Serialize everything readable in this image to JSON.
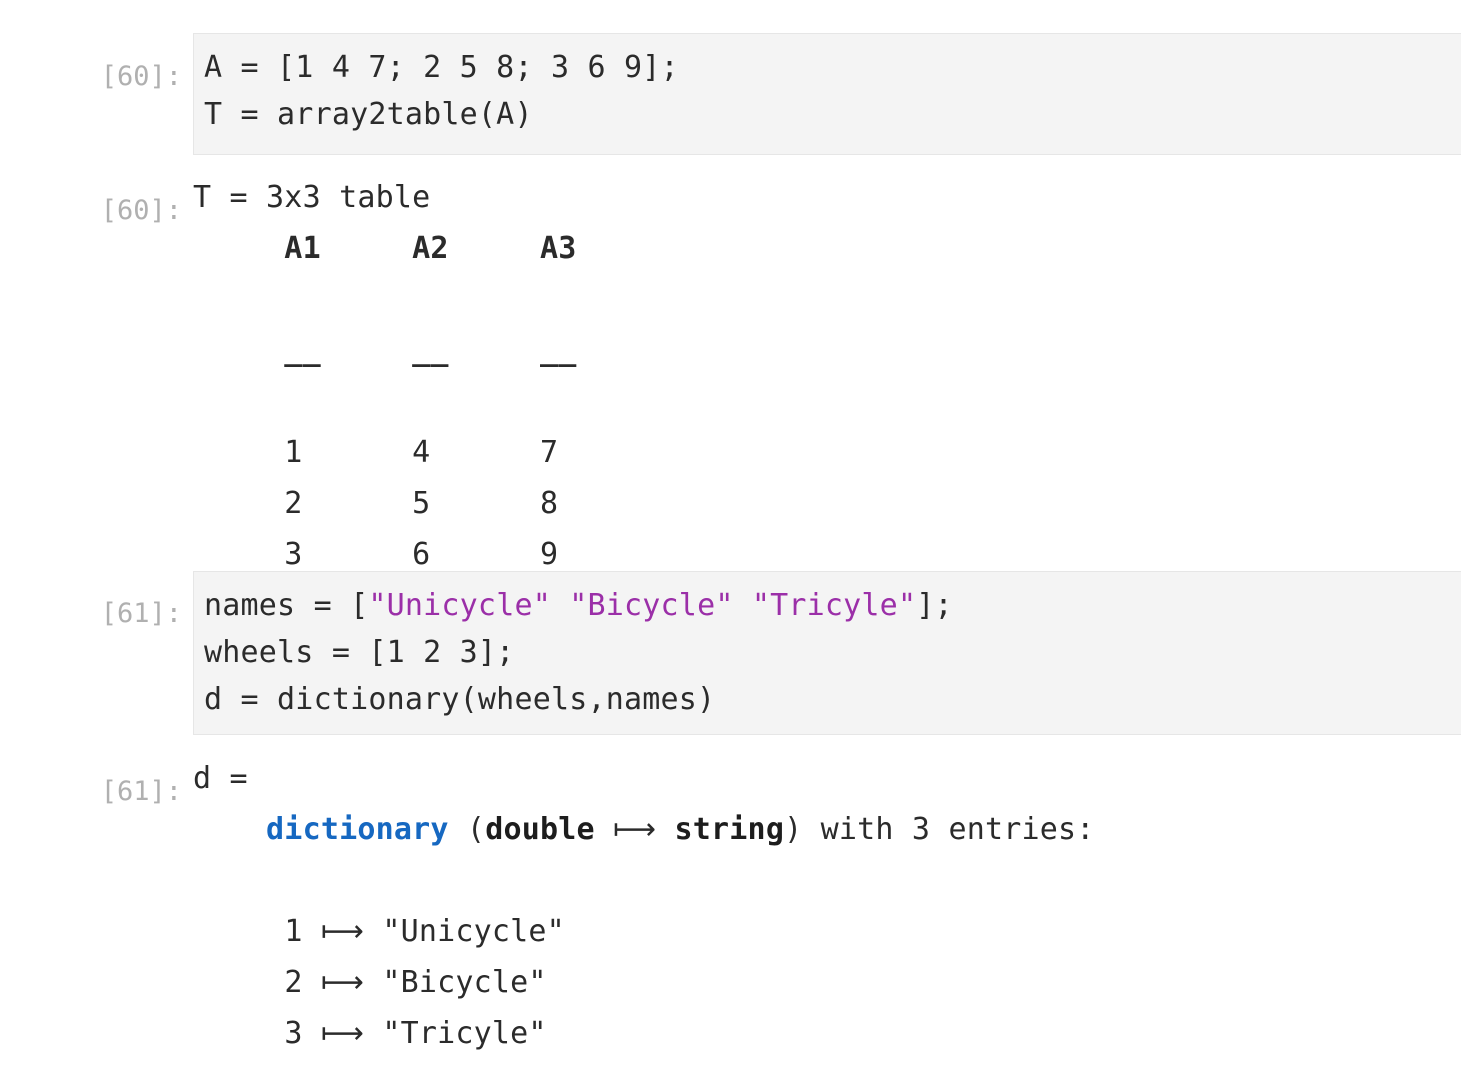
{
  "notebook": {
    "kernel_language": "matlab",
    "colors": {
      "prompt": "#b0b0b0",
      "code_background": "#f4f4f4",
      "code_border": "#e6e6e6",
      "text": "#2b2b2b",
      "string_token": "#9b2fa8",
      "type_token": "#1668c1"
    },
    "cells": [
      {
        "id": "cell-60",
        "input_prompt": "[60]:",
        "output_prompt": "[60]:",
        "code_lines": [
          "A = [1 4 7; 2 5 8; 3 6 9];",
          "T = array2table(A)"
        ],
        "output_lines": [
          "T = 3x3 table",
          "     A1     A2     A3",
          "",
          "     __     __     __",
          "",
          "     1      4      7 ",
          "     2      5      8 ",
          "     3      6      9 "
        ],
        "output_table": {
          "title": "T = 3x3 table",
          "columns": [
            "A1",
            "A2",
            "A3"
          ],
          "rows": [
            [
              "1",
              "4",
              "7"
            ],
            [
              "2",
              "5",
              "8"
            ],
            [
              "3",
              "6",
              "9"
            ]
          ]
        }
      },
      {
        "id": "cell-61",
        "input_prompt": "[61]:",
        "output_prompt": "[61]:",
        "code_lines_parts": [
          [
            {
              "text": "names = [",
              "type": "plain"
            },
            {
              "text": "\"Unicycle\" \"Bicycle\" \"Tricyle\"",
              "type": "string"
            },
            {
              "text": "];",
              "type": "plain"
            }
          ],
          [
            {
              "text": "wheels = [1 2 3];",
              "type": "plain"
            }
          ],
          [
            {
              "text": "d = dictionary(wheels,names)",
              "type": "plain"
            }
          ]
        ],
        "output_header": "d =",
        "output_type_line": {
          "indent": "    ",
          "type_name": "dictionary",
          "open_paren": " (",
          "key_type": "double",
          "mapsto": " ⟼ ",
          "value_type": "string",
          "close": ") with 3 entries:"
        },
        "output_entries": [
          {
            "key": "1",
            "arrow": "⟼",
            "value": "\"Unicycle\""
          },
          {
            "key": "2",
            "arrow": "⟼",
            "value": "\"Bicycle\""
          },
          {
            "key": "3",
            "arrow": "⟼",
            "value": "\"Tricyle\""
          }
        ]
      }
    ]
  }
}
